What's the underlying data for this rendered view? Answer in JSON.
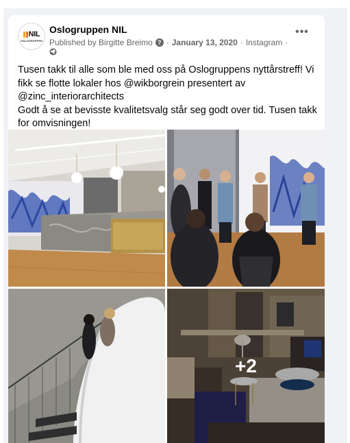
{
  "post": {
    "page_name": "Oslogruppen NIL",
    "avatar_logo_text": "NIL",
    "avatar_logo_subtext": "OSLOGRUPPEN",
    "published_by": "Published by Birgitte Breimo",
    "date": "January 13, 2020",
    "source": "Instagram",
    "separator": "·",
    "more_options_icon": "ellipsis-icon",
    "privacy_icon": "globe-icon",
    "text_lines": [
      "Tusen takk til alle som ble med oss på Oslogruppens nyttårstreff! Vi fikk se flotte lokaler hos @wikborgrein presentert av @zinc_interiorarchitects",
      "Godt å se at bevisste kvalitetsvalg står seg godt over tid. Tusen takk for omvisningen!"
    ]
  },
  "photos": {
    "count": 4,
    "more_label": "+2"
  },
  "colors": {
    "feed_background": "#f0f2f5",
    "card_background": "#ffffff",
    "secondary_text": "#65676b",
    "logo_orange": "#f5a623"
  }
}
